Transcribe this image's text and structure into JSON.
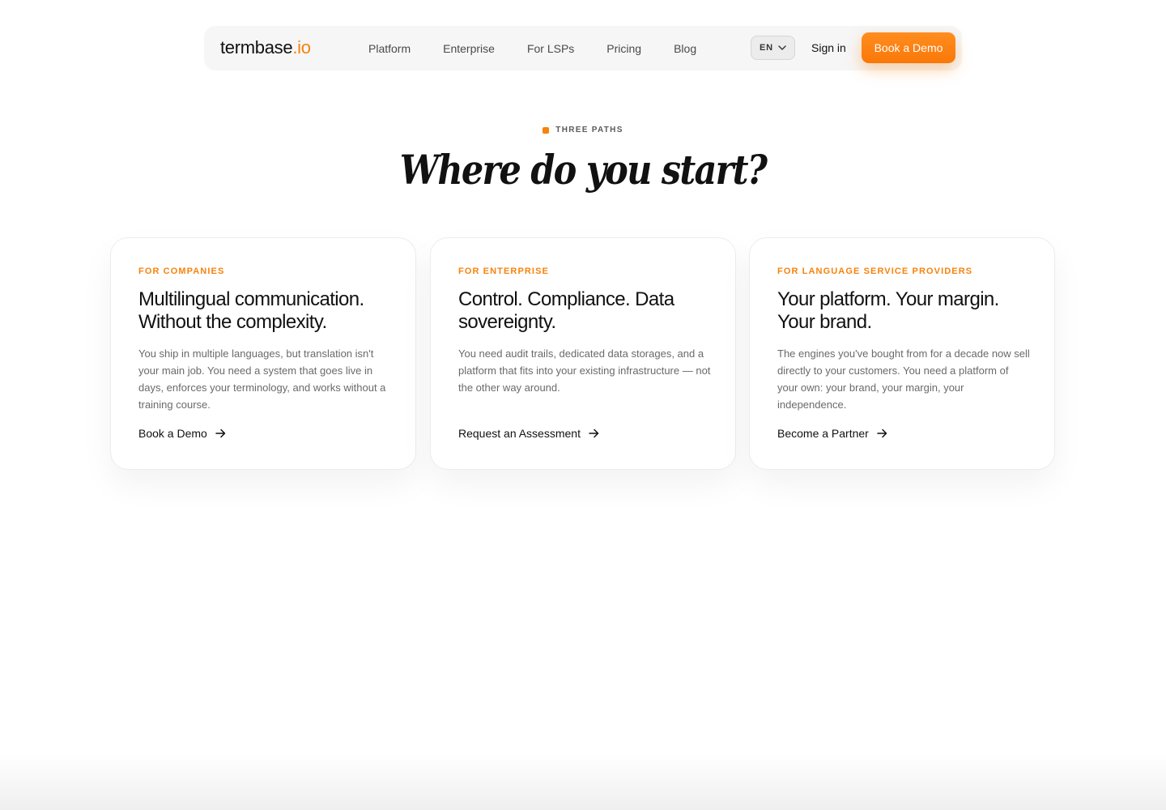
{
  "nav": {
    "logo_main": "termbase",
    "logo_accent": ".io",
    "links": [
      "Platform",
      "Enterprise",
      "For LSPs",
      "Pricing",
      "Blog"
    ],
    "language": "EN",
    "signin_label": "Sign in",
    "demo_label": "Book a Demo"
  },
  "section": {
    "eyebrow": "THREE PATHS",
    "headline": "Where do you start?"
  },
  "cards": [
    {
      "tag": "FOR COMPANIES",
      "title": "Multilingual communication. Without the complexity.",
      "body": "You ship in multiple languages, but translation isn't your main job. You need a system that goes live in days, enforces your terminology, and works without a training course.",
      "cta": "Book a Demo"
    },
    {
      "tag": "FOR ENTERPRISE",
      "title": "Control. Compliance. Data sovereignty.",
      "body": "You need audit trails, dedicated data storages, and a platform that fits into your existing infrastructure — not the other way around.",
      "cta": "Request an Assessment"
    },
    {
      "tag": "FOR LANGUAGE SERVICE PROVIDERS",
      "title": "Your platform. Your margin. Your brand.",
      "body": "The engines you've bought from for a decade now sell directly to your customers. You need a platform of your own: your brand, your margin, your independence.",
      "cta": "Become a Partner"
    }
  ],
  "colors": {
    "accent": "#f7820c",
    "text": "#111111",
    "muted": "#6a6a6a",
    "navbar_bg": "#f6f6f6"
  },
  "icons": {
    "language_chevron": "chevron-down-icon",
    "cta_arrow": "arrow-right-icon"
  }
}
